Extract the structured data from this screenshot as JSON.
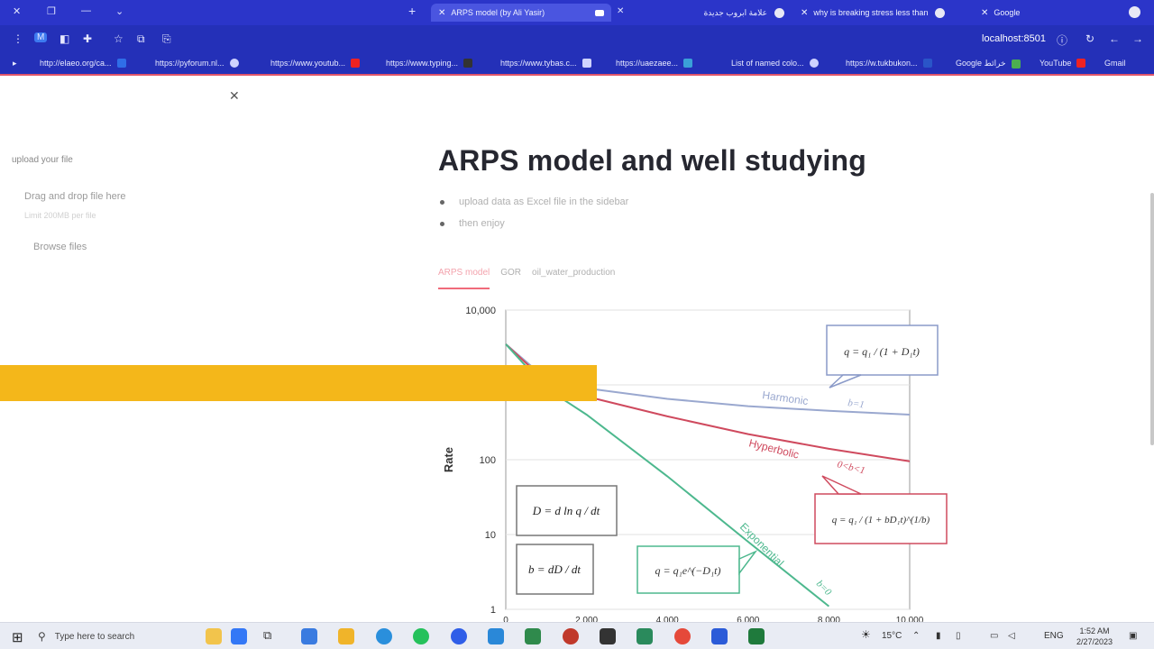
{
  "browser": {
    "tabs": [
      {
        "label": "ARPS model (by Ali Yasir)",
        "active": true
      },
      {
        "label": "علامة ابروب جديدة",
        "active": false
      },
      {
        "label": "why is breaking stress less than",
        "active": false
      },
      {
        "label": "Google",
        "active": false
      }
    ],
    "url": "localhost:8501",
    "bookmarks": [
      "http://elaeo.org/ca...",
      "https://pyforum.nl...",
      "https://www.youtub...",
      "https://www.typing...",
      "https://www.tybas.c...",
      "https://uaezaee...",
      "List of named colo...",
      "https://w.tukbukon...",
      "Google خرائط",
      "YouTube",
      "Gmail"
    ]
  },
  "sidebar": {
    "upload_label": "upload your file",
    "drop_text": "Drag and drop file here",
    "limit_text": "Limit 200MB per file",
    "browse_label": "Browse files"
  },
  "main": {
    "title": "ARPS model and well studying",
    "bullets": [
      "upload data as Excel file in the sidebar",
      "then enjoy"
    ],
    "tabs": [
      {
        "label": "ARPS model",
        "active": true
      },
      {
        "label": "GOR",
        "active": false
      },
      {
        "label": "oil_water_production",
        "active": false
      }
    ]
  },
  "chart_data": {
    "type": "line",
    "ylabel": "Rate",
    "yscale": "log",
    "ylim": [
      1,
      10000
    ],
    "yticks": [
      "10,000",
      "100",
      "10",
      "1"
    ],
    "xticks": [
      "0",
      "2,000",
      "4,000",
      "6,000",
      "8,000",
      "10,000"
    ],
    "xlim": [
      0,
      10000
    ],
    "colors": {
      "harmonic": "#9aa8cf",
      "hyperbolic": "#cf4a5e",
      "exponential": "#4db88e"
    },
    "series": [
      {
        "name": "Harmonic",
        "annotation": "b=1",
        "x": [
          0,
          1000,
          2000,
          4000,
          6000,
          8000,
          10000
        ],
        "values": [
          3500,
          1200,
          900,
          650,
          520,
          450,
          400
        ]
      },
      {
        "name": "Hyperbolic",
        "annotation": "0<b<1",
        "x": [
          0,
          1000,
          2000,
          4000,
          6000,
          8000,
          10000
        ],
        "values": [
          3500,
          1100,
          700,
          380,
          220,
          140,
          95
        ]
      },
      {
        "name": "Exponential",
        "annotation": "b=0",
        "x": [
          0,
          1000,
          2000,
          4000,
          6000,
          8000
        ],
        "values": [
          3500,
          900,
          400,
          60,
          8,
          1.1
        ]
      }
    ],
    "formulas": {
      "harmonic": "q = q₁ / (1 + D₁t)",
      "hyperbolic": "q = q₁ / (1 + bD₁t)^(1/b)",
      "exponential": "q = q₁e^(−D₁t)",
      "decline": "D = d ln q / dt",
      "b_def": "b = dD / dt"
    }
  },
  "taskbar": {
    "search_placeholder": "Type here to search",
    "temperature": "15°C",
    "lang": "ENG",
    "time": "1:52 AM",
    "date": "2/27/2023"
  }
}
